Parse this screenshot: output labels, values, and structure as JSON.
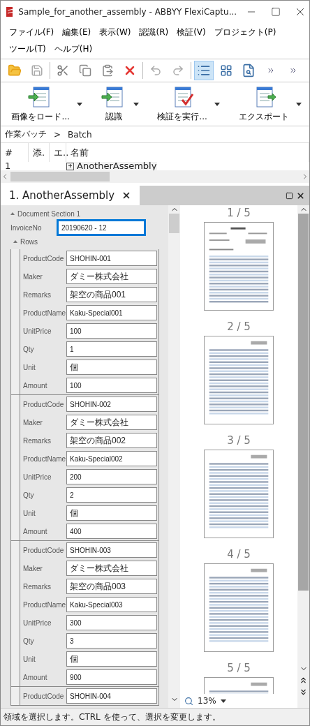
{
  "window": {
    "title": "Sample_for_another_assembly - ABBYY FlexiCaptu..."
  },
  "menu": [
    "ファイル(F)",
    "編集(E)",
    "表示(W)",
    "認識(R)",
    "検証(V)",
    "プロジェクト(P)",
    "ツール(T)",
    "ヘルプ(H)"
  ],
  "big_toolbar": [
    {
      "label": "画像をロード...",
      "kind": "load"
    },
    {
      "label": "認識",
      "kind": "recognize"
    },
    {
      "label": "検証を実行...",
      "kind": "verify"
    },
    {
      "label": "エクスポート",
      "kind": "export"
    }
  ],
  "breadcrumb": [
    "作業バッチ",
    ">",
    "Batch"
  ],
  "table": {
    "columns": [
      "#",
      "添.",
      "エ..",
      "名前"
    ],
    "rows": [
      {
        "number": "1",
        "name": "AnotherAssembly",
        "expanded": false
      }
    ]
  },
  "document_tab": {
    "label": "1. AnotherAssembly"
  },
  "form": {
    "section": "Document Section 1",
    "invoice": {
      "label": "InvoiceNo",
      "value": "20190620 - 12",
      "focused": true
    },
    "rows_label": "Rows",
    "groups": [
      [
        {
          "label": "ProductCode",
          "value": "SHOHIN-001"
        },
        {
          "label": "Maker",
          "value": "ダミー株式会社"
        },
        {
          "label": "Remarks",
          "value": "架空の商品001"
        },
        {
          "label": "ProductName",
          "value": "Kaku-Special001"
        },
        {
          "label": "UnitPrice",
          "value": "100"
        },
        {
          "label": "Qty",
          "value": "1"
        },
        {
          "label": "Unit",
          "value": "個"
        },
        {
          "label": "Amount",
          "value": "100"
        }
      ],
      [
        {
          "label": "ProductCode",
          "value": "SHOHIN-002"
        },
        {
          "label": "Maker",
          "value": "ダミー株式会社"
        },
        {
          "label": "Remarks",
          "value": "架空の商品002"
        },
        {
          "label": "ProductName",
          "value": "Kaku-Special002"
        },
        {
          "label": "UnitPrice",
          "value": "200"
        },
        {
          "label": "Qty",
          "value": "2"
        },
        {
          "label": "Unit",
          "value": "個"
        },
        {
          "label": "Amount",
          "value": "400"
        }
      ],
      [
        {
          "label": "ProductCode",
          "value": "SHOHIN-003"
        },
        {
          "label": "Maker",
          "value": "ダミー株式会社"
        },
        {
          "label": "Remarks",
          "value": "架空の商品003"
        },
        {
          "label": "ProductName",
          "value": "Kaku-Special003"
        },
        {
          "label": "UnitPrice",
          "value": "300"
        },
        {
          "label": "Qty",
          "value": "3"
        },
        {
          "label": "Unit",
          "value": "個"
        },
        {
          "label": "Amount",
          "value": "900"
        }
      ],
      [
        {
          "label": "ProductCode",
          "value": "SHOHIN-004"
        }
      ]
    ]
  },
  "pages": [
    {
      "label": "1 / 5",
      "header": true
    },
    {
      "label": "2 / 5",
      "header": false
    },
    {
      "label": "3 / 5",
      "header": false
    },
    {
      "label": "4 / 5",
      "header": false
    },
    {
      "label": "5 / 5",
      "header": false
    }
  ],
  "zoom": {
    "value": "13%"
  },
  "status_bar": "領域を選択します。CTRL を使って、選択を変更します。"
}
